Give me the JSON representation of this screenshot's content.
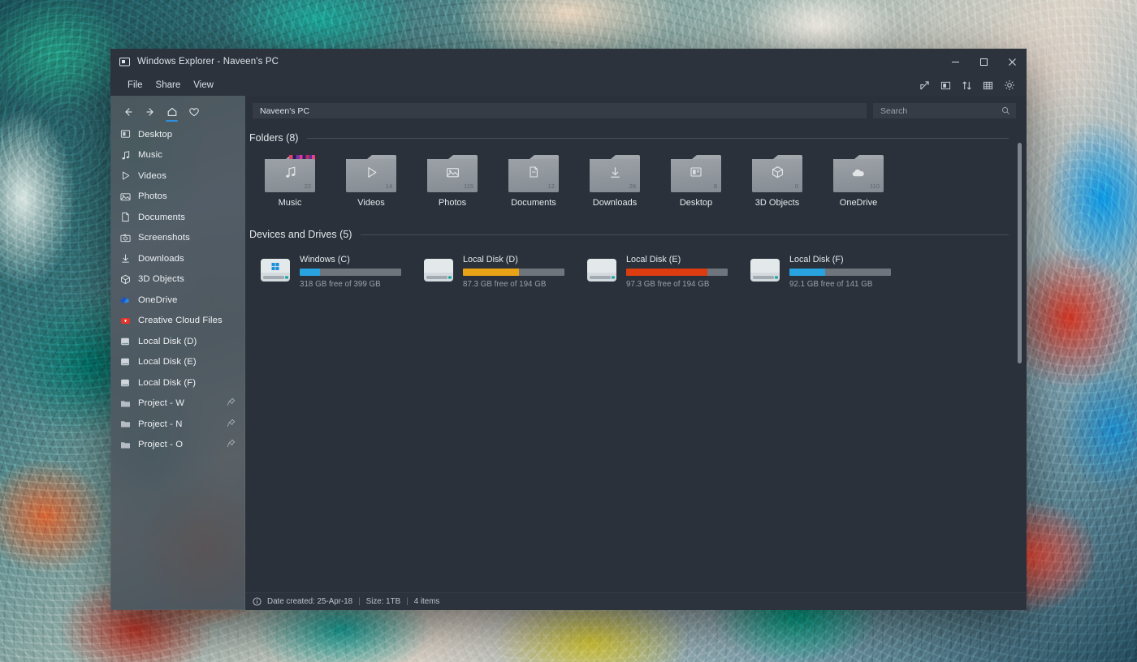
{
  "window": {
    "title": "Windows Explorer - Naveen's PC",
    "app_icon": "display-icon",
    "controls": {
      "minimize": "minimize-icon",
      "maximize": "maximize-icon",
      "close": "close-icon"
    }
  },
  "menubar": {
    "items": [
      {
        "label": "File"
      },
      {
        "label": "Share"
      },
      {
        "label": "View"
      }
    ],
    "tools": [
      {
        "name": "share-icon"
      },
      {
        "name": "preview-pane-icon"
      },
      {
        "name": "sort-icon"
      },
      {
        "name": "grid-view-icon"
      },
      {
        "name": "settings-gear-icon"
      }
    ]
  },
  "nav": {
    "buttons": [
      {
        "name": "back-button",
        "icon": "arrow-left-icon",
        "active": false
      },
      {
        "name": "forward-button",
        "icon": "arrow-right-icon",
        "active": false
      },
      {
        "name": "home-button",
        "icon": "home-icon",
        "active": true
      },
      {
        "name": "favorites-button",
        "icon": "heart-icon",
        "active": false
      }
    ]
  },
  "sidebar": {
    "items": [
      {
        "label": "Desktop",
        "icon": "desktop-icon",
        "pinned": false
      },
      {
        "label": "Music",
        "icon": "music-note-icon",
        "pinned": false
      },
      {
        "label": "Videos",
        "icon": "play-triangle-icon",
        "pinned": false
      },
      {
        "label": "Photos",
        "icon": "photo-icon",
        "pinned": false
      },
      {
        "label": "Documents",
        "icon": "document-icon",
        "pinned": false
      },
      {
        "label": "Screenshots",
        "icon": "screenshot-icon",
        "pinned": false
      },
      {
        "label": "Downloads",
        "icon": "download-arrow-icon",
        "pinned": false
      },
      {
        "label": "3D Objects",
        "icon": "cube-icon",
        "pinned": false
      },
      {
        "label": "OneDrive",
        "icon": "onedrive-cloud-icon",
        "pinned": false
      },
      {
        "label": "Creative Cloud Files",
        "icon": "creative-cloud-icon",
        "pinned": false
      },
      {
        "label": "Local Disk (D)",
        "icon": "drive-icon",
        "pinned": false
      },
      {
        "label": "Local Disk (E)",
        "icon": "drive-icon",
        "pinned": false
      },
      {
        "label": "Local Disk (F)",
        "icon": "drive-icon",
        "pinned": false
      },
      {
        "label": "Project - W",
        "icon": "folder-icon",
        "pinned": true
      },
      {
        "label": "Project - N",
        "icon": "folder-icon",
        "pinned": true
      },
      {
        "label": "Project - O",
        "icon": "folder-icon",
        "pinned": true
      }
    ]
  },
  "address": {
    "path": "Naveen's PC"
  },
  "search": {
    "value": "",
    "placeholder": "Search",
    "icon": "search-icon"
  },
  "folders_section": {
    "title": "Folders (8)",
    "items": [
      {
        "name": "Music",
        "count": "22",
        "glyph": "music-note-icon",
        "has_art": true
      },
      {
        "name": "Videos",
        "count": "14",
        "glyph": "play-triangle-icon",
        "has_art": false
      },
      {
        "name": "Photos",
        "count": "115",
        "glyph": "photo-icon",
        "has_art": false
      },
      {
        "name": "Documents",
        "count": "12",
        "glyph": "document-icon",
        "has_art": false
      },
      {
        "name": "Downloads",
        "count": "26",
        "glyph": "download-arrow-icon",
        "has_art": false
      },
      {
        "name": "Desktop",
        "count": "8",
        "glyph": "desktop-icon",
        "has_art": false
      },
      {
        "name": "3D Objects",
        "count": "0",
        "glyph": "cube-icon",
        "has_art": false
      },
      {
        "name": "OneDrive",
        "count": "110",
        "glyph": "cloud-icon",
        "has_art": false
      }
    ]
  },
  "drives_section": {
    "title": "Devices and Drives (5)",
    "items": [
      {
        "name": "Windows (C)",
        "free_text": "318 GB free of 399 GB",
        "used_percent": 20,
        "bar_color": "#29a3e0",
        "badge": "windows-logo"
      },
      {
        "name": "Local Disk (D)",
        "free_text": "87.3 GB free of 194 GB",
        "used_percent": 55,
        "bar_color": "#e8a317",
        "badge": "none"
      },
      {
        "name": "Local Disk (E)",
        "free_text": "97.3 GB free of 194 GB",
        "used_percent": 80,
        "bar_color": "#dd3c11",
        "badge": "none"
      },
      {
        "name": "Local Disk (F)",
        "free_text": "92.1 GB free of 141 GB",
        "used_percent": 35,
        "bar_color": "#29a3e0",
        "badge": "none"
      }
    ]
  },
  "statusbar": {
    "info_icon": "info-icon",
    "date_created": "Date created: 25-Apr-18",
    "size": "Size: 1TB",
    "items": "4 items",
    "separator": "|"
  },
  "colors": {
    "window_bg": "#2a313a",
    "chrome_bg": "#2c333d",
    "field_bg": "#353c46",
    "accent_blue": "#2f8fe0",
    "text_primary": "#e6eaee",
    "text_muted": "#97a0a9"
  }
}
